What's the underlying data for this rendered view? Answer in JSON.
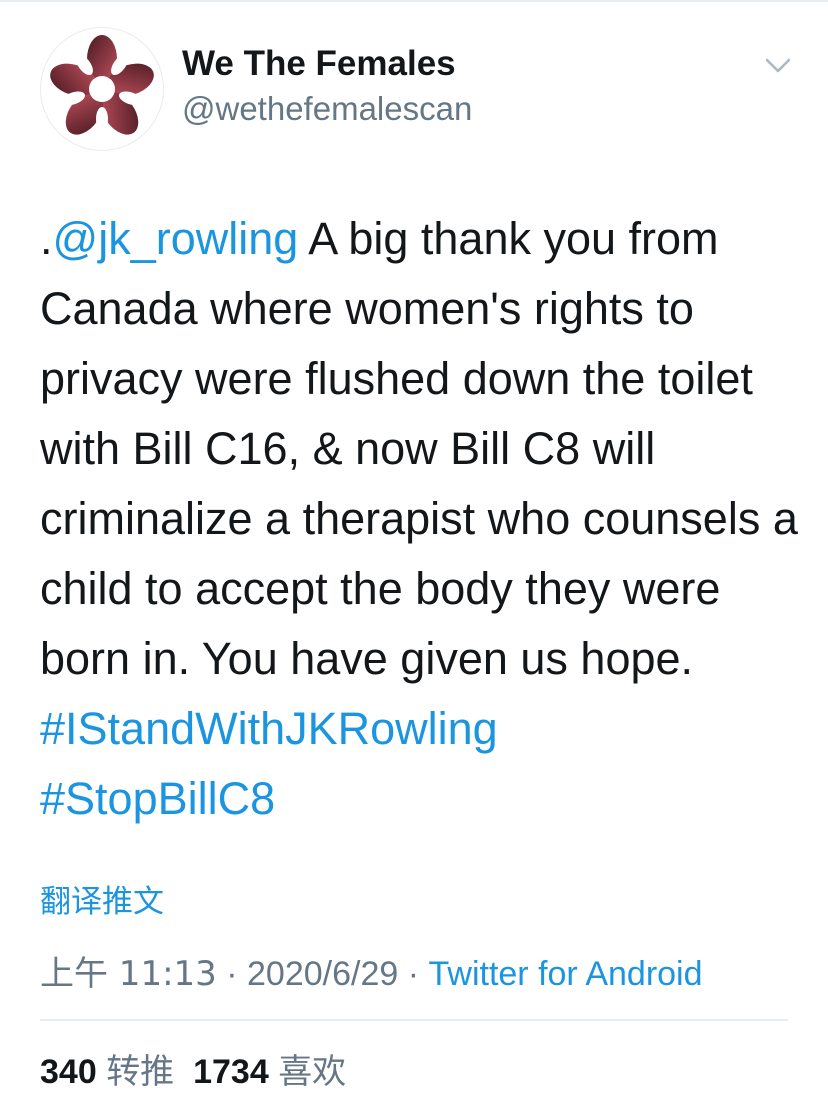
{
  "author": {
    "display_name": "We The Females",
    "handle": "@wethefemalescan",
    "avatar_icon": "flower-logo-icon"
  },
  "menu_icon": "chevron-down-icon",
  "tweet": {
    "prefix": ".",
    "mention": "@jk_rowling",
    "body": " A big thank you from Canada where women's rights to privacy were flushed down the toilet with Bill C16, & now Bill C8 will criminalize a therapist who counsels a child to accept the body they were born in. You have given us hope. ",
    "hashtag_1": "#IStandWithJKRowling",
    "hashtag_2": "#StopBillC8"
  },
  "translate_label": "翻译推文",
  "meta": {
    "time": "上午 11:13",
    "separator": " · ",
    "date": "2020/6/29",
    "source": "Twitter for Android"
  },
  "stats": {
    "retweets_count": "340",
    "retweets_label": "转推",
    "likes_count": "1734",
    "likes_label": "喜欢"
  },
  "colors": {
    "link": "#1b95e0",
    "secondary_text": "#657786",
    "primary_text": "#14171a",
    "avatar_flower": "#8a2f3e"
  }
}
